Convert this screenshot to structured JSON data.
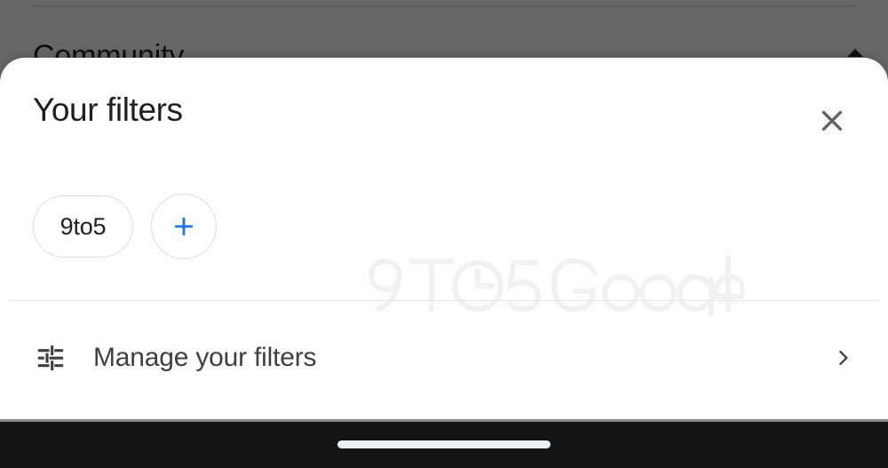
{
  "background": {
    "title": "Community",
    "scrim_color": "#666666",
    "caret_icon": "caret-up-icon"
  },
  "sheet": {
    "title": "Your filters",
    "close_icon": "close-icon",
    "filters": [
      {
        "label": "9to5"
      }
    ],
    "add_filter": {
      "icon": "plus-icon",
      "color": "#1a73e8"
    },
    "manage": {
      "icon": "tune-icon",
      "label": "Manage your filters",
      "chevron_icon": "chevron-right-icon"
    }
  },
  "watermark": {
    "text": "9TO5Google",
    "color": "#f1f1f1"
  },
  "system_nav": {
    "gesture_pill": "home-gesture-pill",
    "background_color": "#141414"
  }
}
